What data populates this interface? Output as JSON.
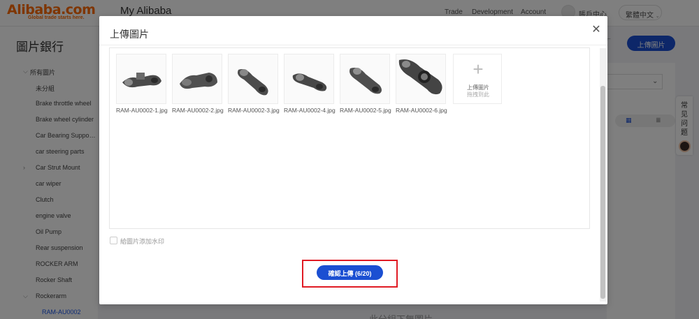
{
  "header": {
    "logo_text": "Alibaba.com",
    "logo_tagline": "Global trade starts here.",
    "app_title": "My Alibaba",
    "nav": [
      "Trade",
      "Development",
      "Account"
    ],
    "user_label": "賬戶中心",
    "language": "繁體中文"
  },
  "sidebar": {
    "title": "圖片銀行",
    "items": [
      {
        "label": "所有圖片"
      },
      {
        "label": "未分組"
      },
      {
        "label": "Brake throttle wheel"
      },
      {
        "label": "Brake wheel cylinder"
      },
      {
        "label": "Car Bearing Supports"
      },
      {
        "label": "car steering parts"
      },
      {
        "label": "Car Strut Mount"
      },
      {
        "label": "car wiper"
      },
      {
        "label": "Clutch"
      },
      {
        "label": "engine valve"
      },
      {
        "label": "Oil Pump"
      },
      {
        "label": "Rear suspension"
      },
      {
        "label": "ROCKER ARM"
      },
      {
        "label": "Rocker Shaft"
      },
      {
        "label": "Rockerarm"
      },
      {
        "label": "RAM-AU0002"
      }
    ]
  },
  "main": {
    "upload_button": "上傳圖片",
    "empty_text": "此分組下無圖片",
    "faq_label": "常见问题"
  },
  "modal": {
    "title": "上傳圖片",
    "files": [
      {
        "name": "RAM-AU0002-1.jpg"
      },
      {
        "name": "RAM-AU0002-2.jpg"
      },
      {
        "name": "RAM-AU0002-3.jpg"
      },
      {
        "name": "RAM-AU0002-4.jpg"
      },
      {
        "name": "RAM-AU0002-5.jpg"
      },
      {
        "name": "RAM-AU0002-6.jpg"
      }
    ],
    "add_tile_label": "上傳圖片",
    "add_tile_sub": "拖拽到此",
    "watermark_label": "給圖片添加水印",
    "confirm_button": "確認上傳 (6/20)"
  },
  "colors": {
    "brand": "#ff6a00",
    "primary": "#1b4fd2",
    "highlight_frame": "#e01b24"
  }
}
